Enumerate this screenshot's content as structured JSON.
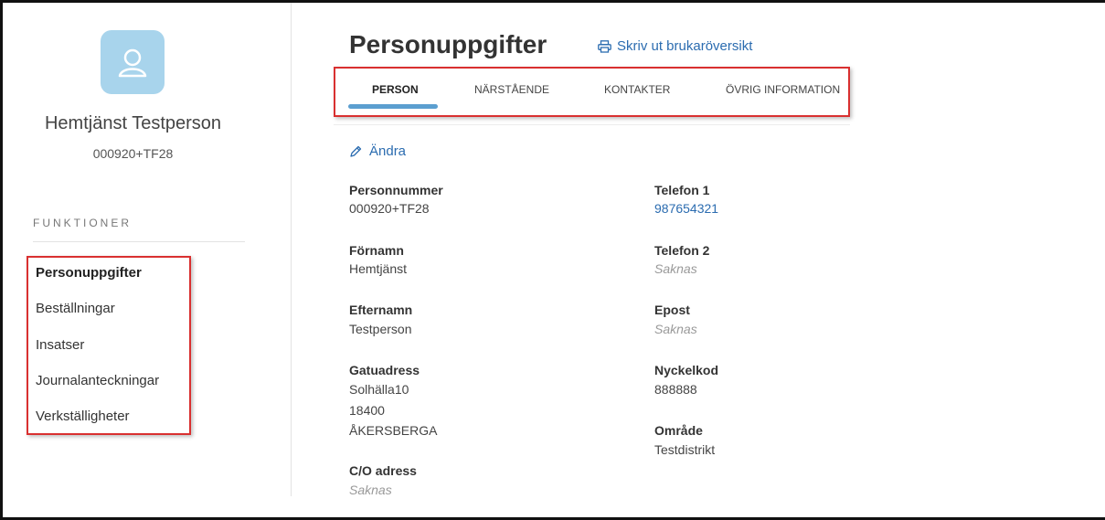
{
  "user": {
    "name": "Hemtjänst Testperson",
    "id": "000920+TF28",
    "avatar_icon": "user-icon"
  },
  "sidebar": {
    "heading": "FUNKTIONER",
    "items": [
      {
        "label": "Personuppgifter",
        "active": true
      },
      {
        "label": "Beställningar",
        "active": false
      },
      {
        "label": "Insatser",
        "active": false
      },
      {
        "label": "Journalanteckningar",
        "active": false
      },
      {
        "label": "Verkställigheter",
        "active": false
      }
    ]
  },
  "header": {
    "title": "Personuppgifter",
    "print_label": "Skriv ut brukaröversikt",
    "print_icon": "printer-icon"
  },
  "tabs": [
    {
      "label": "PERSON",
      "active": true
    },
    {
      "label": "NÄRSTÅENDE",
      "active": false
    },
    {
      "label": "KONTAKTER",
      "active": false
    },
    {
      "label": "ÖVRIG INFORMATION",
      "active": false
    }
  ],
  "edit": {
    "label": "Ändra",
    "icon": "pencil-icon"
  },
  "fields": {
    "personnummer": {
      "label": "Personnummer",
      "value": "000920+TF28"
    },
    "fornamn": {
      "label": "Förnamn",
      "value": "Hemtjänst"
    },
    "efternamn": {
      "label": "Efternamn",
      "value": "Testperson"
    },
    "gatuadress": {
      "label": "Gatuadress",
      "street": "Solhälla10",
      "postcode": "18400",
      "city": "ÅKERSBERGA"
    },
    "co_adress": {
      "label": "C/O adress",
      "value": "Saknas"
    },
    "telefon1": {
      "label": "Telefon 1",
      "value": "987654321"
    },
    "telefon2": {
      "label": "Telefon 2",
      "value": "Saknas"
    },
    "epost": {
      "label": "Epost",
      "value": "Saknas"
    },
    "nyckelkod": {
      "label": "Nyckelkod",
      "value": "888888"
    },
    "omrade": {
      "label": "Område",
      "value": "Testdistrikt"
    }
  },
  "colors": {
    "link": "#2b6cb0",
    "highlight_border": "#d93030",
    "avatar_bg": "#a8d4ec",
    "active_tab_indicator": "#5b9fd0"
  }
}
